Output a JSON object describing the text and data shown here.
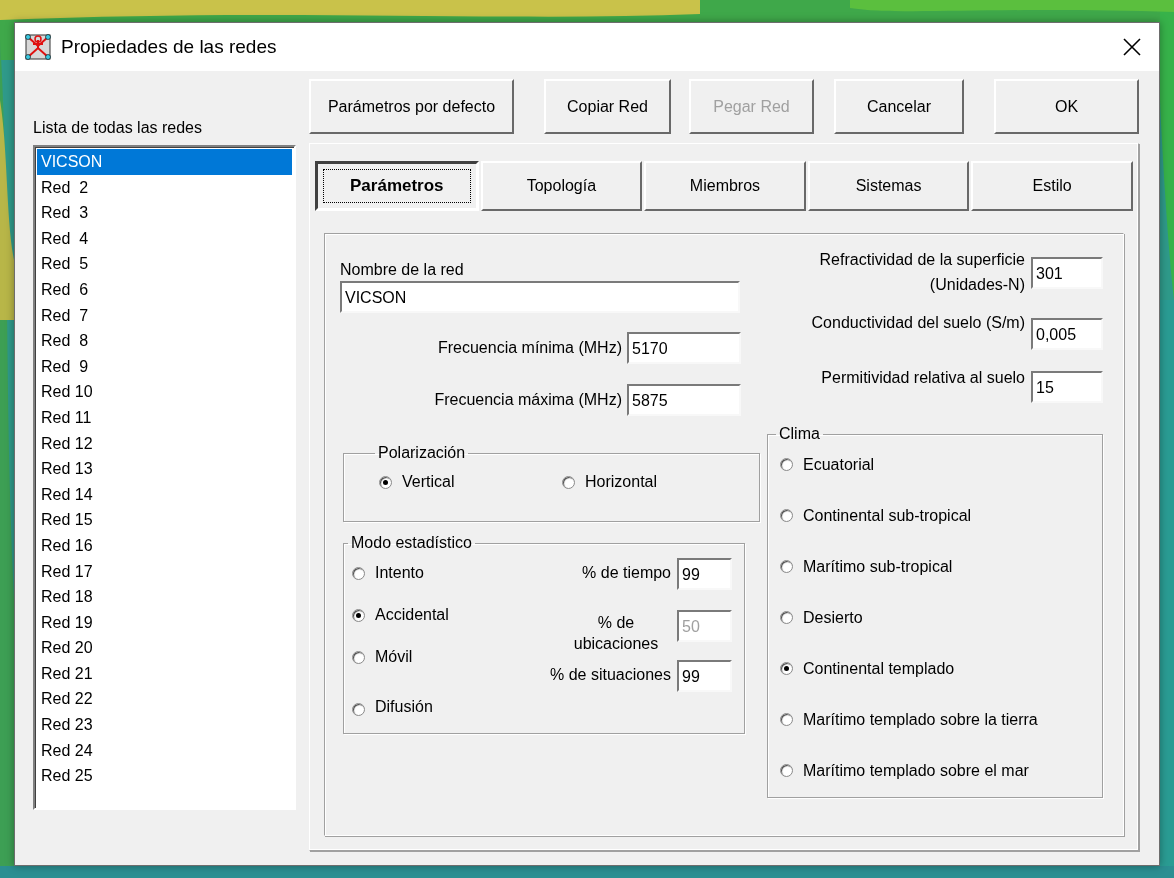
{
  "window": {
    "title": "Propiedades de las redes"
  },
  "buttons": [
    {
      "label": "Parámetros por defecto",
      "disabled": false
    },
    {
      "label": "Copiar Red",
      "disabled": false
    },
    {
      "label": "Pegar Red",
      "disabled": true
    },
    {
      "label": "Cancelar",
      "disabled": false
    },
    {
      "label": "OK",
      "disabled": false
    }
  ],
  "network_list": {
    "label": "Lista de todas las redes",
    "items": [
      {
        "label": "VICSON",
        "selected": true
      },
      {
        "label": "Red  2",
        "selected": false
      },
      {
        "label": "Red  3",
        "selected": false
      },
      {
        "label": "Red  4",
        "selected": false
      },
      {
        "label": "Red  5",
        "selected": false
      },
      {
        "label": "Red  6",
        "selected": false
      },
      {
        "label": "Red  7",
        "selected": false
      },
      {
        "label": "Red  8",
        "selected": false
      },
      {
        "label": "Red  9",
        "selected": false
      },
      {
        "label": "Red 10",
        "selected": false
      },
      {
        "label": "Red 11",
        "selected": false
      },
      {
        "label": "Red 12",
        "selected": false
      },
      {
        "label": "Red 13",
        "selected": false
      },
      {
        "label": "Red 14",
        "selected": false
      },
      {
        "label": "Red 15",
        "selected": false
      },
      {
        "label": "Red 16",
        "selected": false
      },
      {
        "label": "Red 17",
        "selected": false
      },
      {
        "label": "Red 18",
        "selected": false
      },
      {
        "label": "Red 19",
        "selected": false
      },
      {
        "label": "Red 20",
        "selected": false
      },
      {
        "label": "Red 21",
        "selected": false
      },
      {
        "label": "Red 22",
        "selected": false
      },
      {
        "label": "Red 23",
        "selected": false
      },
      {
        "label": "Red 24",
        "selected": false
      },
      {
        "label": "Red 25",
        "selected": false
      }
    ]
  },
  "tabs": [
    {
      "label": "Parámetros",
      "selected": true
    },
    {
      "label": "Topología",
      "selected": false
    },
    {
      "label": "Miembros",
      "selected": false
    },
    {
      "label": "Sistemas",
      "selected": false
    },
    {
      "label": "Estilo",
      "selected": false
    }
  ],
  "parameters": {
    "network_name": {
      "label": "Nombre de la red",
      "value": "VICSON"
    },
    "min_frequency": {
      "label": "Frecuencia mínima (MHz)",
      "value": "5170"
    },
    "max_frequency": {
      "label": "Frecuencia máxima (MHz)",
      "value": "5875"
    },
    "refractivity": {
      "label": "Refractividad de la superficie (Unidades-N)",
      "value": "301"
    },
    "conductivity": {
      "label": "Conductividad del suelo (S/m)",
      "value": "0,005"
    },
    "permittivity": {
      "label": "Permitividad relativa al suelo",
      "value": "15"
    },
    "polarization": {
      "label": "Polarización",
      "options": [
        {
          "label": "Vertical",
          "selected": true
        },
        {
          "label": "Horizontal",
          "selected": false
        }
      ]
    },
    "statistical_mode": {
      "label": "Modo estadístico",
      "options": [
        {
          "label": "Intento",
          "selected": false
        },
        {
          "label": "Accidental",
          "selected": true
        },
        {
          "label": "Móvil",
          "selected": false
        },
        {
          "label": "Difusión",
          "selected": false
        }
      ],
      "fields": [
        {
          "label": "% de tiempo",
          "value": "99",
          "disabled": false
        },
        {
          "label": "% de ubicaciones",
          "value": "50",
          "disabled": true
        },
        {
          "label": "% de situaciones",
          "value": "99",
          "disabled": false
        }
      ]
    },
    "climate": {
      "label": "Clima",
      "options": [
        {
          "label": "Ecuatorial",
          "selected": false
        },
        {
          "label": "Continental sub-tropical",
          "selected": false
        },
        {
          "label": "Marítimo sub-tropical",
          "selected": false
        },
        {
          "label": "Desierto",
          "selected": false
        },
        {
          "label": "Continental templado",
          "selected": true
        },
        {
          "label": "Marítimo templado sobre la tierra",
          "selected": false
        },
        {
          "label": "Marítimo templado sobre el mar",
          "selected": false
        }
      ]
    }
  }
}
